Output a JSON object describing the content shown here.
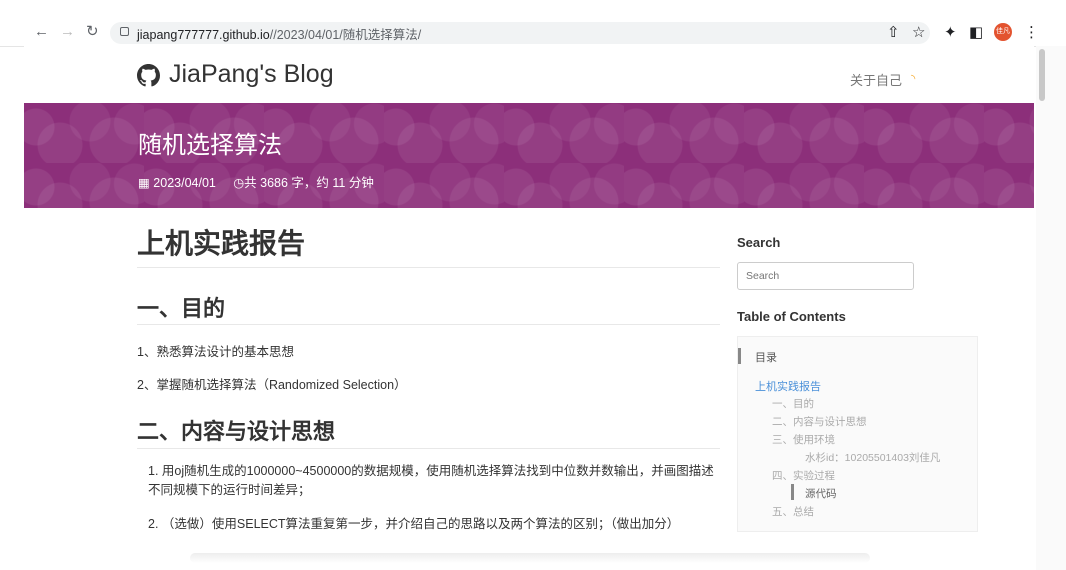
{
  "browser": {
    "url_host": "jiapang777777.github.io",
    "url_path": "//2023/04/01/随机选择算法/",
    "avatar_text": "佳凡",
    "icons": [
      "back-icon",
      "forward-icon",
      "reload-icon",
      "lock-icon",
      "share-icon",
      "star-icon",
      "extensions-icon",
      "sidebar-icon",
      "menu-icon"
    ]
  },
  "nav": {
    "brand": "JiaPang's Blog",
    "about": "关于自己",
    "rss_glyph": "☰"
  },
  "hero": {
    "title": "随机选择算法",
    "date": "2023/04/01",
    "words": "共 3686 字，约 11 分钟"
  },
  "post": {
    "h1": "上机实践报告",
    "s1": "一、目的",
    "s1_items": [
      "1、熟悉算法设计的基本思想",
      "2、掌握随机选择算法（Randomized Selection）"
    ],
    "s2": "二、内容与设计思想",
    "s2_items": [
      "1. 用oj随机生成的1000000~4500000的数据规模，使用随机选择算法找到中位数并数输出，并画图描述不同规模下的运行时间差异；",
      "2. （选做）使用SELECT算法重复第一步，并介绍自己的思路以及两个算法的区别；（做出加分）"
    ]
  },
  "sidebar": {
    "search_title": "Search",
    "search_placeholder": "Search",
    "toc_title": "Table of Contents",
    "toc_header": "目录",
    "toc": {
      "i0": "上机实践报告",
      "i1": "一、目的",
      "i2": "二、内容与设计思想",
      "i3": "三、使用环境",
      "i4": "水杉id：10205501403刘佳凡",
      "i5": "四、实验过程",
      "i6": "源代码",
      "i7": "五、总结"
    }
  },
  "colors": {
    "hero": "#8c2f7a",
    "toc_link": "#4a90d9",
    "rss": "#f5a623"
  }
}
